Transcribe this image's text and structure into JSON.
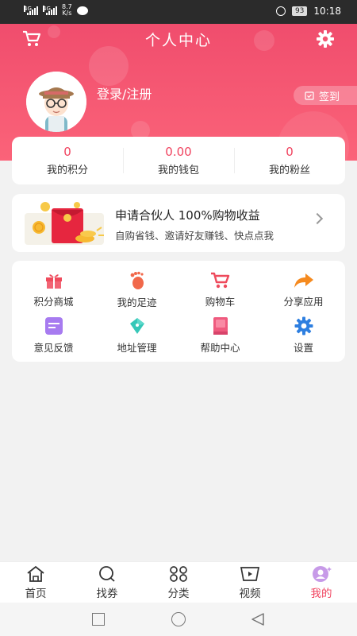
{
  "status_bar": {
    "signal_tag_1": "4G",
    "signal_tag_2": "4G",
    "speed_value": "8.7",
    "speed_unit": "K/s",
    "battery": "93",
    "time": "10:18"
  },
  "header": {
    "title": "个人中心",
    "login_text": "登录/注册",
    "signin_label": "签到"
  },
  "stats": [
    {
      "value": "0",
      "label": "我的积分"
    },
    {
      "value": "0.00",
      "label": "我的钱包"
    },
    {
      "value": "0",
      "label": "我的粉丝"
    }
  ],
  "partner": {
    "title": "申请合伙人 100%购物收益",
    "subtitle": "自购省钱、邀请好友赚钱、快点点我"
  },
  "grid": {
    "items": [
      {
        "label": "积分商城",
        "icon": "gift-icon"
      },
      {
        "label": "我的足迹",
        "icon": "footprint-icon"
      },
      {
        "label": "购物车",
        "icon": "shopping-cart-icon"
      },
      {
        "label": "分享应用",
        "icon": "share-icon"
      },
      {
        "label": "意见反馈",
        "icon": "feedback-icon"
      },
      {
        "label": "地址管理",
        "icon": "compass-icon"
      },
      {
        "label": "帮助中心",
        "icon": "help-book-icon"
      },
      {
        "label": "设置",
        "icon": "settings-gear-icon"
      }
    ]
  },
  "tabbar": {
    "items": [
      {
        "label": "首页",
        "icon": "home-icon"
      },
      {
        "label": "找券",
        "icon": "search-icon"
      },
      {
        "label": "分类",
        "icon": "category-icon"
      },
      {
        "label": "视频",
        "icon": "video-icon"
      },
      {
        "label": "我的",
        "icon": "profile-icon",
        "active": true
      }
    ]
  },
  "colors": {
    "brand": "#f04d6d",
    "accent_text": "#f0435f",
    "background": "#f2f2f2"
  }
}
